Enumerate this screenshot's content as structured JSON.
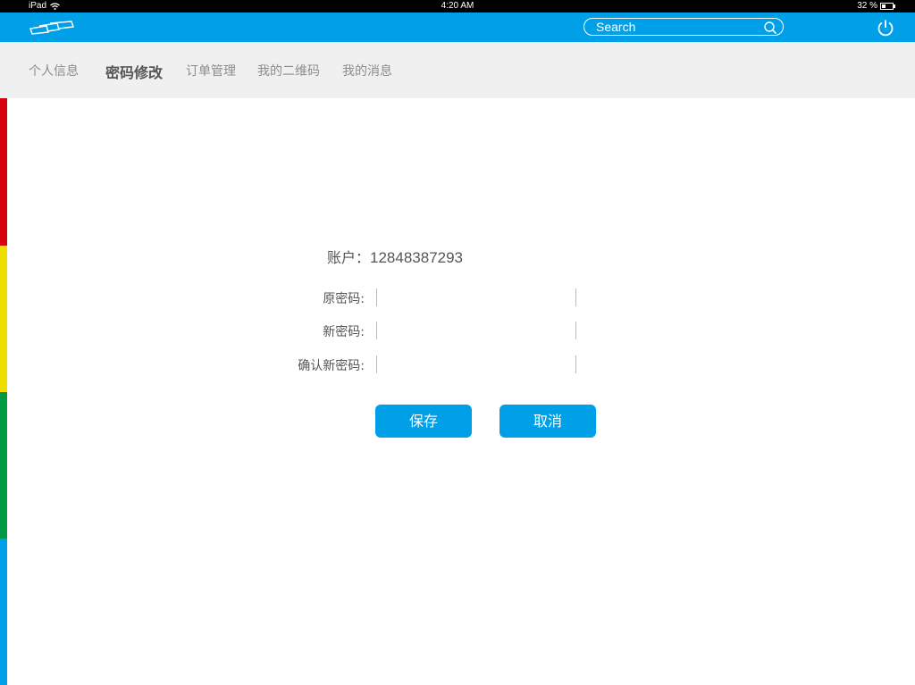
{
  "status_bar": {
    "device": "iPad",
    "time": "4:20 AM",
    "battery": "32 %",
    "battery_level": 0.32
  },
  "header": {
    "search_placeholder": "Search"
  },
  "tabs": [
    {
      "label": "个人信息",
      "active": false
    },
    {
      "label": "密码修改",
      "active": true
    },
    {
      "label": "订单管理",
      "active": false
    },
    {
      "label": "我的二维码",
      "active": false
    },
    {
      "label": "我的消息",
      "active": false
    }
  ],
  "form": {
    "account_label": "账户：",
    "account_value": "12848387293",
    "old_password_label": "原密码:",
    "new_password_label": "新密码:",
    "confirm_password_label": "确认新密码:",
    "old_password_value": "",
    "new_password_value": "",
    "confirm_password_value": ""
  },
  "buttons": {
    "save": "保存",
    "cancel": "取消"
  },
  "colors": {
    "accent": "#00a0e9",
    "stripe_red": "#d7000f",
    "stripe_yellow": "#eedd00",
    "stripe_green": "#009944",
    "stripe_blue": "#00a0e9",
    "tab_bar_bg": "#f0f0f0"
  }
}
